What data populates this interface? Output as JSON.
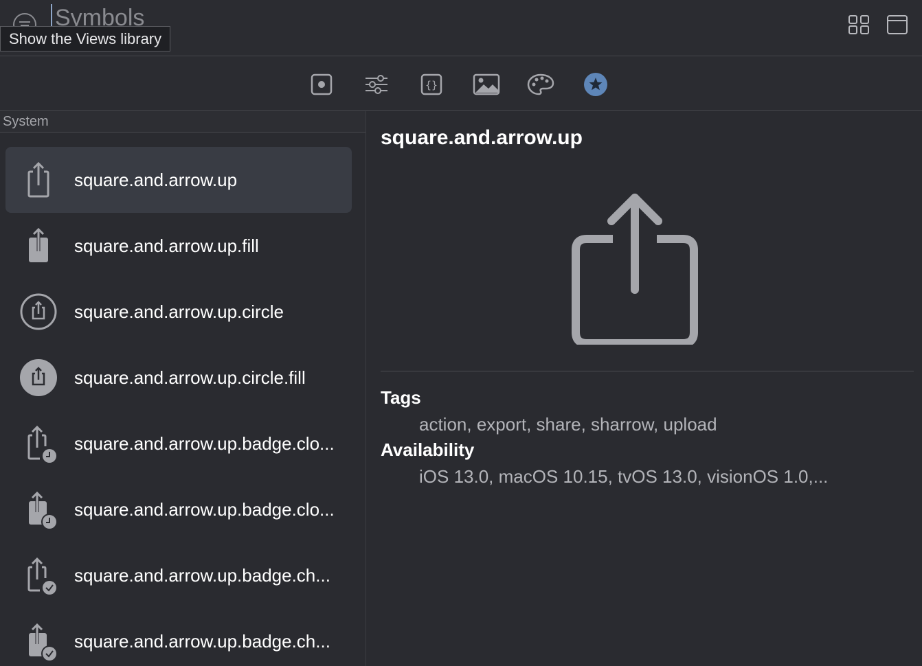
{
  "search": {
    "value": "Symbols"
  },
  "tooltip": {
    "text": "Show the Views library"
  },
  "tabs": [
    {
      "name": "views",
      "icon": "square-dot-icon"
    },
    {
      "name": "modifiers",
      "icon": "sliders-icon"
    },
    {
      "name": "snippets",
      "icon": "braces-icon"
    },
    {
      "name": "images",
      "icon": "photo-icon"
    },
    {
      "name": "colors",
      "icon": "palette-icon"
    },
    {
      "name": "symbols",
      "icon": "star-circle-icon",
      "selected": true
    }
  ],
  "sidebar": {
    "section_title": "System",
    "items": [
      {
        "label": "square.and.arrow.up",
        "icon": "square-arrow-up-icon",
        "selected": true
      },
      {
        "label": "square.and.arrow.up.fill",
        "icon": "square-arrow-up-fill-icon"
      },
      {
        "label": "square.and.arrow.up.circle",
        "icon": "square-arrow-up-circle-icon"
      },
      {
        "label": "square.and.arrow.up.circle.fill",
        "icon": "square-arrow-up-circle-fill-icon"
      },
      {
        "label": "square.and.arrow.up.badge.clo...",
        "icon": "square-arrow-up-badge-clock-icon"
      },
      {
        "label": "square.and.arrow.up.badge.clo...",
        "icon": "square-arrow-up-badge-clock-fill-icon"
      },
      {
        "label": "square.and.arrow.up.badge.ch...",
        "icon": "square-arrow-up-badge-check-icon"
      },
      {
        "label": "square.and.arrow.up.badge.ch...",
        "icon": "square-arrow-up-badge-check-fill-icon"
      }
    ]
  },
  "detail": {
    "title": "square.and.arrow.up",
    "tags_heading": "Tags",
    "tags_value": "action, export, share, sharrow, upload",
    "availability_heading": "Availability",
    "availability_value": "iOS 13.0, macOS 10.15, tvOS 13.0, visionOS 1.0,..."
  },
  "colors": {
    "background": "#2a2b30",
    "selection": "#393c44",
    "accent": "#5e86b8",
    "icon_gray": "#a5a6ab"
  }
}
